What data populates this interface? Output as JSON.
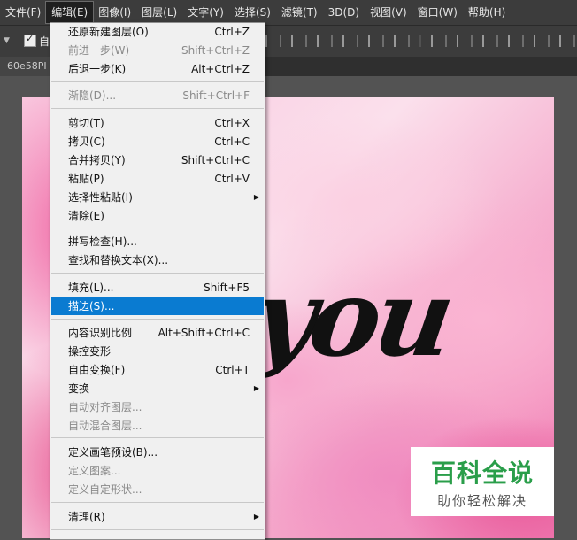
{
  "menubar": {
    "items": [
      "文件(F)",
      "编辑(E)",
      "图像(I)",
      "图层(L)",
      "文字(Y)",
      "选择(S)",
      "滤镜(T)",
      "3D(D)",
      "视图(V)",
      "窗口(W)",
      "帮助(H)"
    ],
    "active_index": 1
  },
  "options_bar": {
    "auto_label": "自"
  },
  "document_tab": {
    "name": "60e58PI"
  },
  "canvas": {
    "text": "you"
  },
  "watermark": {
    "logo": "百科全说",
    "subtitle": "助你轻松解决"
  },
  "edit_menu": {
    "items": [
      {
        "label": "还原新建图层(O)",
        "shortcut": "Ctrl+Z",
        "disabled": false
      },
      {
        "label": "前进一步(W)",
        "shortcut": "Shift+Ctrl+Z",
        "disabled": true
      },
      {
        "label": "后退一步(K)",
        "shortcut": "Alt+Ctrl+Z",
        "disabled": false
      },
      {
        "label": "渐隐(D)...",
        "shortcut": "Shift+Ctrl+F",
        "disabled": true
      },
      {
        "label": "剪切(T)",
        "shortcut": "Ctrl+X",
        "disabled": false
      },
      {
        "label": "拷贝(C)",
        "shortcut": "Ctrl+C",
        "disabled": false
      },
      {
        "label": "合并拷贝(Y)",
        "shortcut": "Shift+Ctrl+C",
        "disabled": false
      },
      {
        "label": "粘贴(P)",
        "shortcut": "Ctrl+V",
        "disabled": false
      },
      {
        "label": "选择性粘贴(I)",
        "shortcut": "",
        "disabled": false,
        "submenu": true
      },
      {
        "label": "清除(E)",
        "shortcut": "",
        "disabled": false
      },
      {
        "label": "拼写检查(H)...",
        "shortcut": "",
        "disabled": false
      },
      {
        "label": "查找和替换文本(X)...",
        "shortcut": "",
        "disabled": false
      },
      {
        "label": "填充(L)...",
        "shortcut": "Shift+F5",
        "disabled": false
      },
      {
        "label": "描边(S)...",
        "shortcut": "",
        "disabled": false,
        "highlighted": true
      },
      {
        "label": "内容识别比例",
        "shortcut": "Alt+Shift+Ctrl+C",
        "disabled": false
      },
      {
        "label": "操控变形",
        "shortcut": "",
        "disabled": false
      },
      {
        "label": "自由变换(F)",
        "shortcut": "Ctrl+T",
        "disabled": false
      },
      {
        "label": "变换",
        "shortcut": "",
        "disabled": false,
        "submenu": true
      },
      {
        "label": "自动对齐图层...",
        "shortcut": "",
        "disabled": true
      },
      {
        "label": "自动混合图层...",
        "shortcut": "",
        "disabled": true
      },
      {
        "label": "定义画笔预设(B)...",
        "shortcut": "",
        "disabled": false
      },
      {
        "label": "定义图案...",
        "shortcut": "",
        "disabled": true
      },
      {
        "label": "定义自定形状...",
        "shortcut": "",
        "disabled": true
      },
      {
        "label": "清理(R)",
        "shortcut": "",
        "disabled": false,
        "submenu": true
      }
    ]
  },
  "colors": {
    "highlight": "#0a7bd1",
    "menu_bg": "#f0f0f0",
    "disabled_text": "#8a8a8a",
    "watermark_green": "#2a9e4a"
  }
}
